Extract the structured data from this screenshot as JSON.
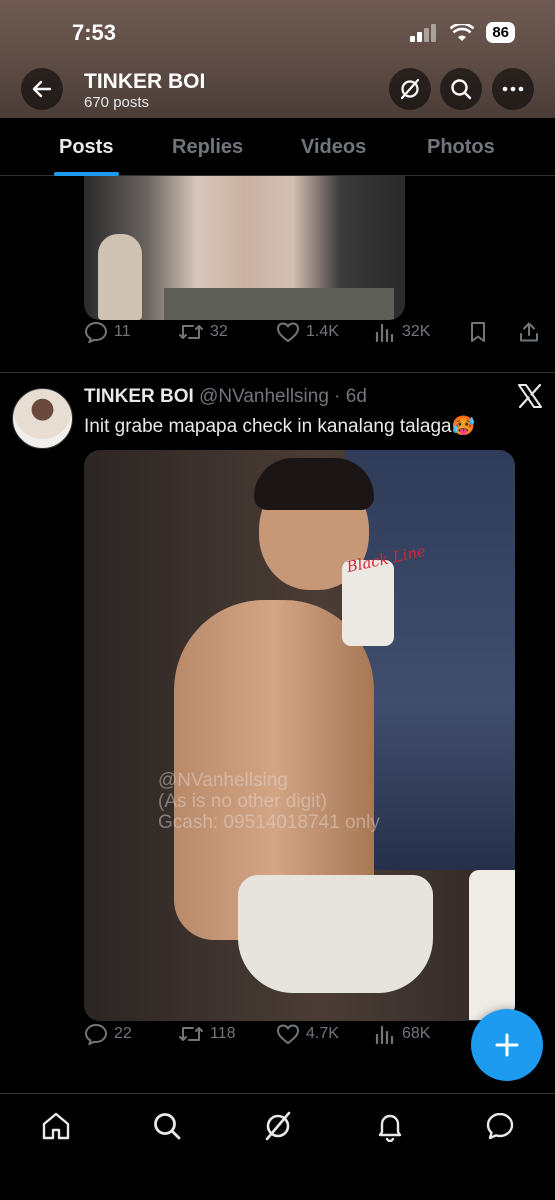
{
  "status_bar": {
    "time": "7:53",
    "battery": "86"
  },
  "profile": {
    "name": "TINKER BOI",
    "post_count": "670 posts"
  },
  "tabs": [
    {
      "label": "Posts",
      "active": true
    },
    {
      "label": "Replies",
      "active": false
    },
    {
      "label": "Videos",
      "active": false
    },
    {
      "label": "Photos",
      "active": false
    }
  ],
  "post1": {
    "replies": "11",
    "reposts": "32",
    "likes": "1.4K",
    "views": "32K"
  },
  "post2": {
    "name": "TINKER BOI",
    "handle_time": "@NVanhellsing · 6d",
    "text": "Init grabe mapapa check in kanalang talaga🥵",
    "watermark": "@NVanhellsing\n(As is no other digit)\nGcash: 09514018741 only",
    "signature": "Black Line",
    "replies": "22",
    "reposts": "118",
    "likes": "4.7K",
    "views": "68K"
  },
  "colors": {
    "accent": "#1d9bf0",
    "muted": "#71767b",
    "background": "#000000"
  },
  "icons": [
    "back-arrow-icon",
    "grok-icon",
    "search-icon",
    "more-icon",
    "reply-icon",
    "repost-icon",
    "like-icon",
    "views-icon",
    "bookmark-icon",
    "share-icon",
    "x-logo-icon",
    "compose-icon",
    "home-icon",
    "bell-icon",
    "messages-icon"
  ]
}
